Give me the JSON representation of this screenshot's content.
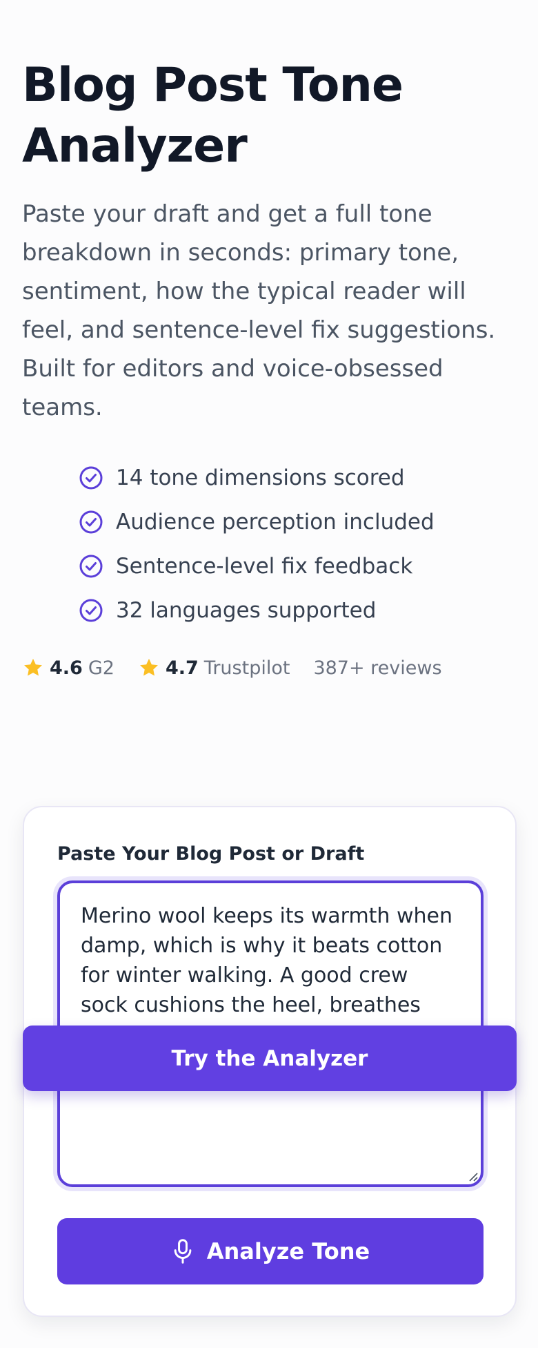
{
  "hero": {
    "title": "Blog Post Tone Analyzer",
    "subtitle": "Paste your draft and get a full tone breakdown in seconds: primary tone, sentiment, how the typical reader will feel, and sentence-level fix suggestions. Built for editors and voice-obsessed teams."
  },
  "features": [
    {
      "label": "14 tone dimensions scored",
      "icon": "check-circle-icon"
    },
    {
      "label": "Audience perception included",
      "icon": "check-circle-icon"
    },
    {
      "label": "Sentence-level fix feedback",
      "icon": "check-circle-icon"
    },
    {
      "label": "32 languages supported",
      "icon": "check-circle-icon"
    }
  ],
  "ratings": {
    "g2": {
      "score": "4.6",
      "source": "G2"
    },
    "trustpilot": {
      "score": "4.7",
      "source": "Trustpilot"
    },
    "reviews": "387+ reviews"
  },
  "form": {
    "label": "Paste Your Blog Post or Draft",
    "draft_text": "Merino wool keeps its warmth when damp, which is why it beats cotton for winter walking. A good crew sock cushions the heel, breathes across the arch, and holds pairs and rotate them.",
    "analyze_label": "Analyze Tone"
  },
  "sticky_cta": {
    "label": "Try the Analyzer"
  },
  "colors": {
    "accent": "#5f3de0",
    "star": "#fbbf24",
    "check": "#5b3fd9"
  }
}
